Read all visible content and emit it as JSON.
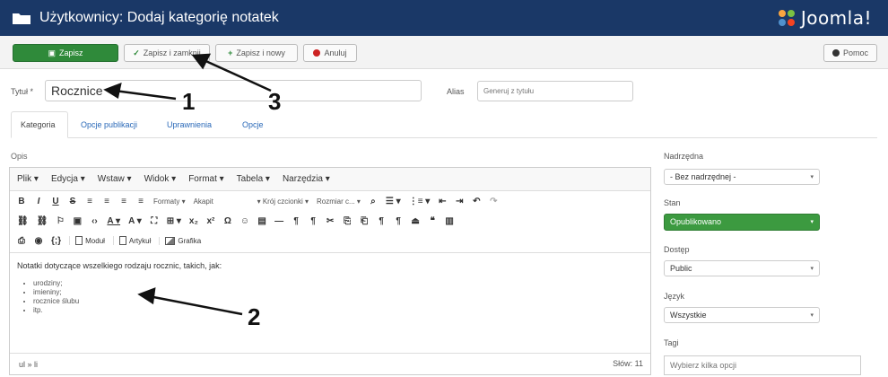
{
  "header": {
    "title": "Użytkownicy: Dodaj kategorię notatek",
    "brand": "Joomla!"
  },
  "toolbar": {
    "save": "Zapisz",
    "save_close": "Zapisz i zamknij",
    "save_new": "Zapisz i nowy",
    "cancel": "Anuluj",
    "help": "Pomoc"
  },
  "form": {
    "title_label": "Tytuł *",
    "title_value": "Rocznice",
    "alias_label": "Alias",
    "alias_placeholder": "Generuj z tytułu"
  },
  "tabs": [
    "Kategoria",
    "Opcje publikacji",
    "Uprawnienia",
    "Opcje"
  ],
  "editor": {
    "label": "Opis",
    "menus": [
      "Plik",
      "Edycja",
      "Wstaw",
      "Widok",
      "Format",
      "Tabela",
      "Narzędzia"
    ],
    "formats_label": "Formaty",
    "paragraph_label": "Akapit",
    "font_label": "Krój czcionki",
    "size_label": "Rozmiar c...",
    "btn_module": "Moduł",
    "btn_article": "Artykuł",
    "btn_image": "Grafika",
    "content_intro": "Notatki dotyczące wszelkiego rodzaju rocznic, takich, jak:",
    "content_items": [
      "urodziny;",
      "imieniny;",
      "rocznice ślubu",
      "itp."
    ],
    "path": "ul » li",
    "words": "Słów: 11"
  },
  "right": {
    "parent_label": "Nadrzędna",
    "parent_value": "- Bez nadrzędnej -",
    "status_label": "Stan",
    "status_value": "Opublikowano",
    "access_label": "Dostęp",
    "access_value": "Public",
    "language_label": "Język",
    "language_value": "Wszystkie",
    "tags_label": "Tagi",
    "tags_placeholder": "Wybierz kilka opcji"
  },
  "annotations": [
    "1",
    "2",
    "3"
  ],
  "colors": {
    "header": "#1a3867",
    "save": "#2f8a3a",
    "status": "#3c9a40",
    "link": "#2a69b8"
  }
}
